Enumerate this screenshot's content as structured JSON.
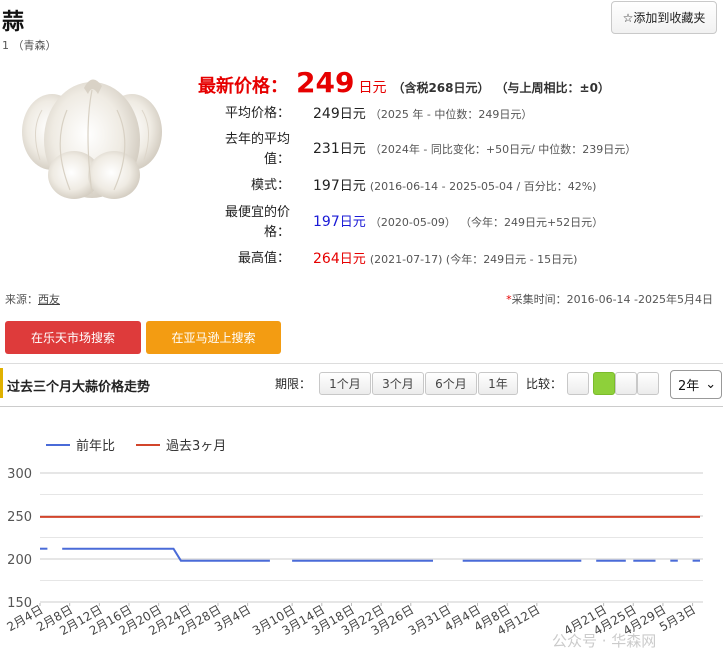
{
  "header": {
    "title": "蒜",
    "subtitle": "1 （青森）",
    "favorite_label": "☆添加到收藏夹"
  },
  "product_image": {
    "alt": "garlic"
  },
  "latest": {
    "label": "最新价格：",
    "value": "249",
    "unit": "日元",
    "tax": "（含税268日元）",
    "compare": "（与上周相比：±0）"
  },
  "stats": {
    "average": {
      "label": "平均价格：",
      "value": "249",
      "unit": "日元",
      "note": "（2025 年 - 中位数：249日元）"
    },
    "last_year": {
      "label_line1": "去年的平均",
      "label_line2": "值：",
      "value": "231",
      "unit": "日元",
      "note_a": "（2024年 - 同比变化：",
      "note_b": "+50日元",
      "note_c": "/ 中位数：239日元）"
    },
    "mode": {
      "label": "模式：",
      "value": "197",
      "unit": "日元",
      "note": "(2016-06-14 - 2025-05-04 / 百分比：42%)"
    },
    "cheapest": {
      "label_line1": "最便宜的价",
      "label_line2": "格：",
      "value": "197",
      "unit": "日元",
      "note_a": "（2020-05-09）",
      "note_b": "（今年：249日元",
      "note_c": "+52日元",
      "note_d": "）"
    },
    "highest": {
      "label": "最高值：",
      "value": "264",
      "unit": "日元",
      "note_a": "(2021-07-17) (今年：249日元 - ",
      "note_b": "15日元",
      "note_c": ")"
    }
  },
  "meta": {
    "source_label": "来源：",
    "source_link": "西友",
    "collect_star": "*",
    "collect_text": "采集时间：2016-06-14 -2025年5月4日"
  },
  "buttons": {
    "rakuten": "在乐天市场搜索",
    "amazon": "在亚马逊上搜索"
  },
  "trend": {
    "title": "过去三个月大蒜价格走势",
    "period_label": "期限：",
    "periods": [
      "1个月",
      "3个月",
      "6个月",
      "1年"
    ],
    "compare_label": "比较：",
    "select_value": "2年",
    "select_arrow": "⌄"
  },
  "watermark": "公众号 · 华森网",
  "chart_data": {
    "type": "line",
    "series": [
      {
        "name": "前年比",
        "color": "#4a6bd8",
        "segments": [
          [
            [
              "2025-02-04",
              212
            ],
            [
              "2025-02-05",
              212
            ]
          ],
          [
            [
              "2025-02-07",
              212
            ],
            [
              "2025-02-22",
              212
            ],
            [
              "2025-02-23",
              198
            ],
            [
              "2025-03-07",
              198
            ]
          ],
          [
            [
              "2025-03-10",
              198
            ],
            [
              "2025-03-29",
              198
            ]
          ],
          [
            [
              "2025-04-02",
              198
            ],
            [
              "2025-04-18",
              198
            ]
          ],
          [
            [
              "2025-04-20",
              198
            ],
            [
              "2025-04-24",
              198
            ]
          ],
          [
            [
              "2025-04-25",
              198
            ],
            [
              "2025-04-28",
              198
            ]
          ],
          [
            [
              "2025-04-30",
              198
            ],
            [
              "2025-05-01",
              198
            ]
          ],
          [
            [
              "2025-05-03",
              198
            ],
            [
              "2025-05-04",
              198
            ]
          ]
        ]
      },
      {
        "name": "過去3ヶ月",
        "color": "#d2452b",
        "segments": [
          [
            [
              "2025-02-04",
              249
            ],
            [
              "2025-05-04",
              249
            ]
          ]
        ]
      }
    ],
    "x_ticks": [
      "2月4日",
      "2月8日",
      "2月12日",
      "2月16日",
      "2月20日",
      "2月24日",
      "2月28日",
      "3月4日",
      "3月10日",
      "3月14日",
      "3月18日",
      "3月22日",
      "3月26日",
      "3月31日",
      "4月4日",
      "4月8日",
      "4月12日",
      "4月21日",
      "4月25日",
      "4月29日",
      "5月3日"
    ],
    "x_tick_dates": [
      "2025-02-04",
      "2025-02-08",
      "2025-02-12",
      "2025-02-16",
      "2025-02-20",
      "2025-02-24",
      "2025-02-28",
      "2025-03-04",
      "2025-03-10",
      "2025-03-14",
      "2025-03-18",
      "2025-03-22",
      "2025-03-26",
      "2025-03-31",
      "2025-04-04",
      "2025-04-08",
      "2025-04-12",
      "2025-04-21",
      "2025-04-25",
      "2025-04-29",
      "2025-05-03"
    ],
    "y_ticks": [
      150,
      200,
      250,
      300
    ],
    "ylim": [
      150,
      300
    ],
    "xlim": [
      "2025-02-04",
      "2025-05-04"
    ],
    "grid": true,
    "legend": "top-left"
  }
}
